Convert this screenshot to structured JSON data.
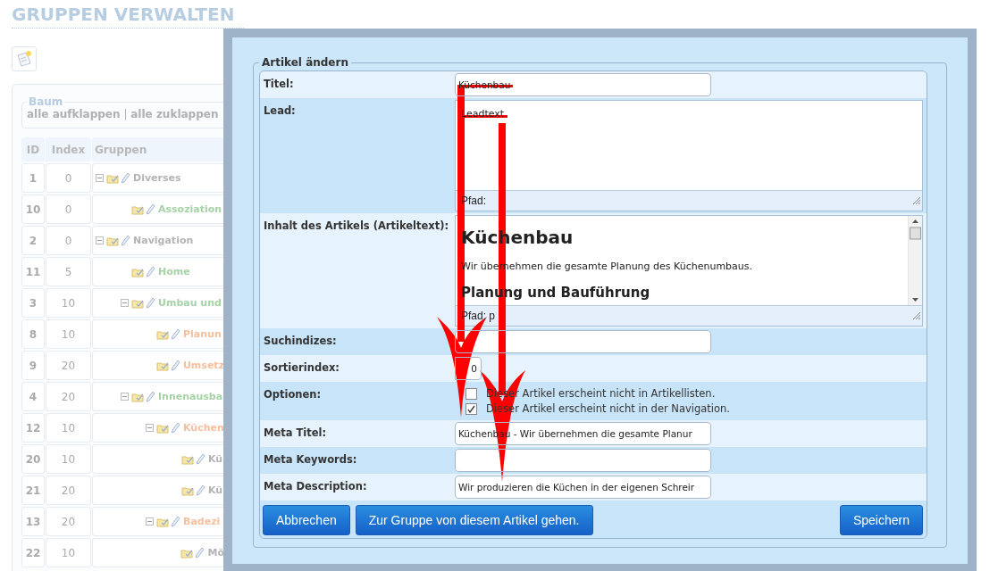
{
  "page": {
    "title": "GRUPPEN VERWALTEN"
  },
  "tree_panel": {
    "legend": "Baum",
    "links": [
      "alle aufklappen",
      "alle zuklappen"
    ],
    "separator": "|"
  },
  "groups_table": {
    "columns": [
      "ID",
      "Index",
      "Gruppen"
    ],
    "rows": [
      {
        "id": "1",
        "index": "0",
        "name": "Diverses",
        "color": "#b4b4b4",
        "expanded": true,
        "children": [
          {
            "id": "10",
            "index": "0",
            "name": "Assoziation",
            "color": "#a6d3a6"
          }
        ]
      },
      {
        "id": "2",
        "index": "0",
        "name": "Navigation",
        "color": "#b4b4b4",
        "expanded": true,
        "children": [
          {
            "id": "11",
            "index": "5",
            "name": "Home",
            "color": "#a6d3a6"
          },
          {
            "id": "3",
            "index": "10",
            "name": "Umbau und",
            "color": "#a6d3a6",
            "expanded": true,
            "children": [
              {
                "id": "8",
                "index": "10",
                "name": "Planun",
                "color": "#f7bf9c"
              },
              {
                "id": "9",
                "index": "20",
                "name": "Umsetz",
                "color": "#f7bf9c"
              }
            ]
          },
          {
            "id": "4",
            "index": "20",
            "name": "Innenausba",
            "color": "#a6d3a6",
            "expanded": true,
            "children": [
              {
                "id": "12",
                "index": "10",
                "name": "Küchen",
                "color": "#f7bf9c",
                "expanded": true,
                "children": [
                  {
                    "id": "20",
                    "index": "10",
                    "name": "Kü",
                    "color": "#b4b4b4"
                  },
                  {
                    "id": "21",
                    "index": "20",
                    "name": "Kü",
                    "color": "#b4b4b4"
                  }
                ]
              },
              {
                "id": "13",
                "index": "20",
                "name": "Badezi",
                "color": "#f7bf9c",
                "expanded": true,
                "children": [
                  {
                    "id": "22",
                    "index": "10",
                    "name": "Mö",
                    "color": "#b4b4b4"
                  }
                ]
              }
            ]
          }
        ]
      }
    ]
  },
  "dialog": {
    "legend": "Artikel ändern",
    "fields": [
      {
        "kind": "text",
        "label": "Titel:",
        "value": "Küchenbau"
      },
      {
        "kind": "textarea",
        "label": "Lead:",
        "value": "Leadtext",
        "path": "Pfad:"
      },
      {
        "kind": "editor",
        "label": "Inhalt des Artikels (Artikeltext):",
        "heading": "Küchenbau",
        "paragraph": "Wir übernehmen die gesamte Planung des Küchenumbaus.",
        "subheading": "Planung und Bauführung",
        "path": "Pfad: p"
      },
      {
        "kind": "text",
        "label": "Suchindizes:"
      },
      {
        "kind": "short",
        "label": "Sortierindex:",
        "value": "0"
      },
      {
        "kind": "options",
        "label": "Optionen:",
        "options": [
          {
            "label": "Dieser Artikel erscheint nicht in Artikellisten.",
            "checked": false
          },
          {
            "label": "Dieser Artikel erscheint nicht in der Navigation.",
            "checked": true
          }
        ]
      },
      {
        "kind": "text",
        "label": "Meta Titel:",
        "value": "Küchenbau - Wir übernehmen die gesamte Planur"
      },
      {
        "kind": "text",
        "label": "Meta Keywords:"
      },
      {
        "kind": "text",
        "label": "Meta Description:",
        "value": "Wir produzieren die Küchen in der eigenen Schreir"
      }
    ],
    "left_buttons": [
      "Abbrechen",
      "Zur Gruppe von diesem Artikel gehen."
    ],
    "right_buttons": [
      "Speichern"
    ]
  }
}
